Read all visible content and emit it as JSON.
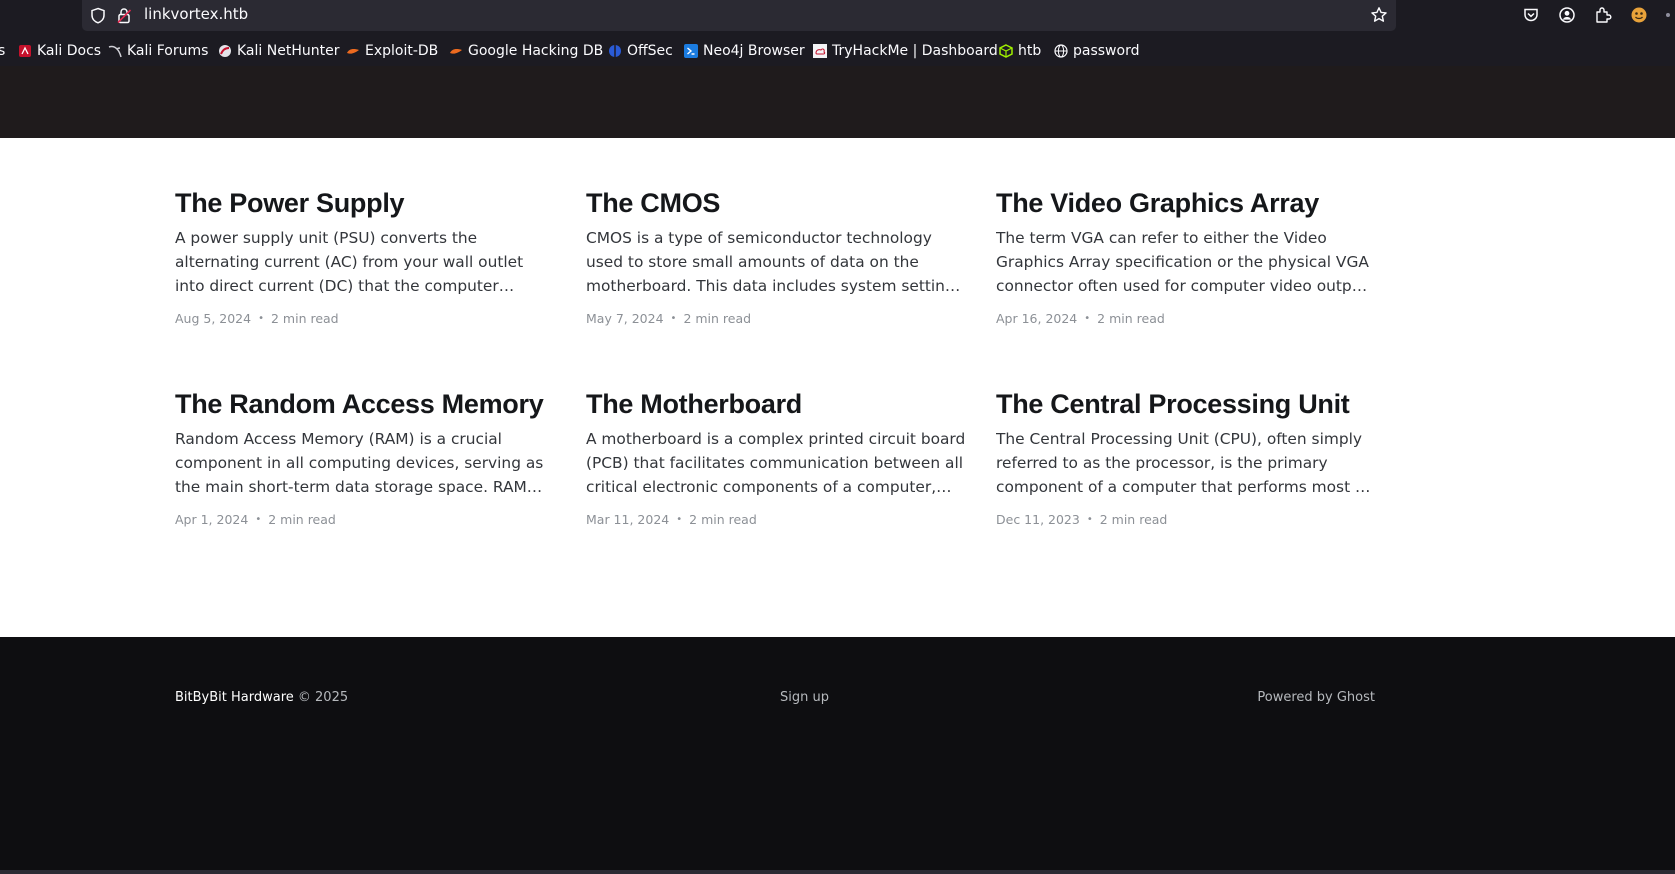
{
  "browser": {
    "url": "linkvortex.htb",
    "bookmarks": [
      {
        "label": "s",
        "icon": "truncated-bookmark-icon"
      },
      {
        "label": "Kali Docs",
        "icon": "kali-docs-icon"
      },
      {
        "label": "Kali Forums",
        "icon": "kali-dragon-icon"
      },
      {
        "label": "Kali NetHunter",
        "icon": "nethunter-icon"
      },
      {
        "label": "Exploit-DB",
        "icon": "exploitdb-icon"
      },
      {
        "label": "Google Hacking DB",
        "icon": "ghdb-icon"
      },
      {
        "label": "OffSec",
        "icon": "offsec-icon"
      },
      {
        "label": "Neo4j Browser",
        "icon": "neo4j-icon"
      },
      {
        "label": "TryHackMe | Dashboard",
        "icon": "tryhackme-icon"
      },
      {
        "label": "htb",
        "icon": "htb-cube-icon"
      },
      {
        "label": "password",
        "icon": "globe-icon"
      }
    ]
  },
  "posts": [
    {
      "title": "The Power Supply",
      "excerpt": "A power supply unit (PSU) converts the alternating current (AC) from your wall outlet into direct current (DC) that the computer components require. It…",
      "date": "Aug 5, 2024",
      "read": "2 min read"
    },
    {
      "title": "The CMOS",
      "excerpt": "CMOS is a type of semiconductor technology used to store small amounts of data on the motherboard. This data includes system settings and configuratio…",
      "date": "May 7, 2024",
      "read": "2 min read"
    },
    {
      "title": "The Video Graphics Array",
      "excerpt": "The term VGA can refer to either the Video Graphics Array specification or the physical VGA connector often used for computer video output. Below, I'll…",
      "date": "Apr 16, 2024",
      "read": "2 min read"
    },
    {
      "title": "The Random Access Memory",
      "excerpt": "Random Access Memory (RAM) is a crucial component in all computing devices, serving as the main short-term data storage space. RAM stores th…",
      "date": "Apr 1, 2024",
      "read": "2 min read"
    },
    {
      "title": "The Motherboard",
      "excerpt": "A motherboard is a complex printed circuit board (PCB) that facilitates communication between all critical electronic components of a computer,…",
      "date": "Mar 11, 2024",
      "read": "2 min read"
    },
    {
      "title": "The Central Processing Unit",
      "excerpt": "The Central Processing Unit (CPU), often simply referred to as the processor, is the primary component of a computer that performs most of th…",
      "date": "Dec 11, 2023",
      "read": "2 min read"
    }
  ],
  "footer": {
    "brand": "BitByBit Hardware",
    "copyright": " © 2025",
    "signup": "Sign up",
    "powered": "Powered by Ghost"
  },
  "colors": {
    "chrome_bg": "#1c1b22",
    "urlbar_bg": "#2b2a33",
    "header_bg": "#1f1b1c",
    "footer_bg": "#0e0e11",
    "title_text": "#15171a",
    "meta_text": "#8c9096"
  }
}
